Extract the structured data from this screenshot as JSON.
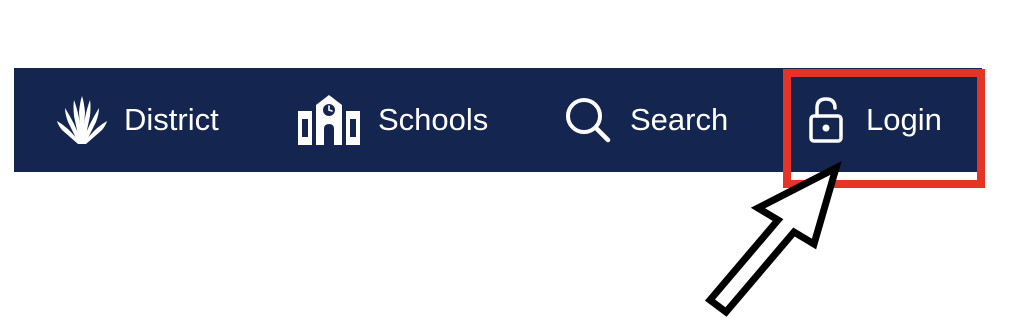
{
  "navbar": {
    "background": "#14254f",
    "items": [
      {
        "label": "District",
        "icon": "grass-logo-icon"
      },
      {
        "label": "Schools",
        "icon": "school-building-icon"
      },
      {
        "label": "Search",
        "icon": "search-icon"
      },
      {
        "label": "Login",
        "icon": "unlocked-padlock-icon"
      }
    ]
  },
  "annotation": {
    "highlight_color": "#e53426",
    "highlight_target": "Login",
    "arrow_color": "#000000",
    "arrow_icon": "arrow-pointer-icon"
  }
}
